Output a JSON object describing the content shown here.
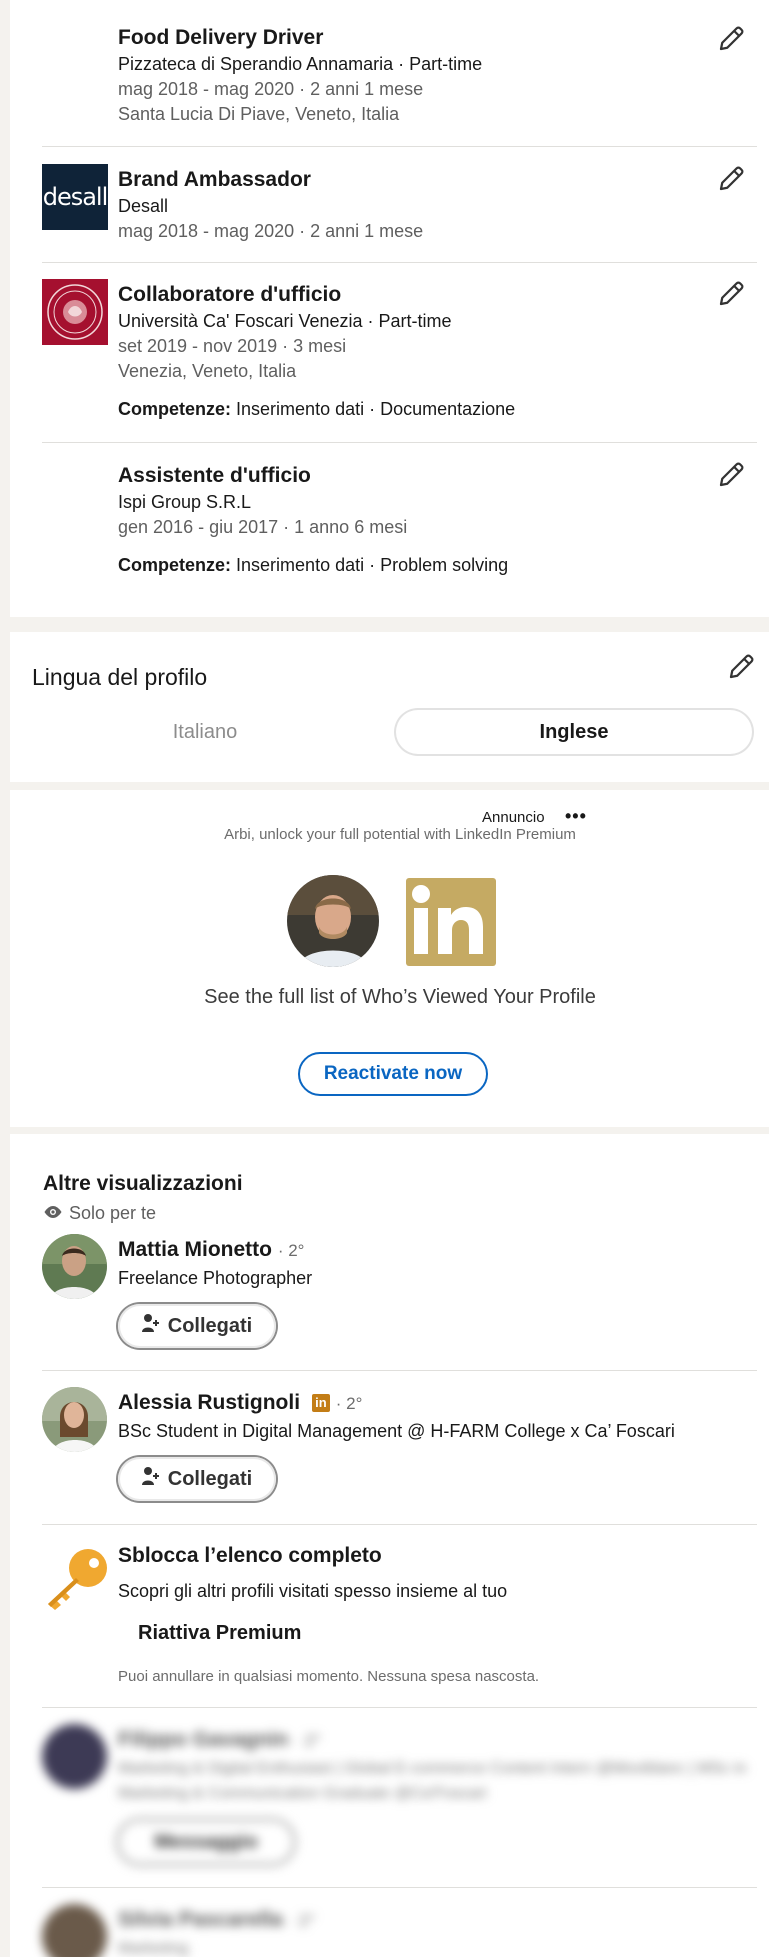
{
  "experience": [
    {
      "title": "Food Delivery Driver",
      "company": "Pizzateca di Sperandio Annamaria · Part-time",
      "dates": "mag 2018 - mag 2020 · 2 anni 1 mese",
      "location": "Santa Lucia Di Piave, Veneto, Italia"
    },
    {
      "title": "Brand Ambassador",
      "company": "Desall",
      "dates": "mag 2018 - mag 2020 · 2 anni 1 mese",
      "logo_text": "desall"
    },
    {
      "title": "Collaboratore d'ufficio",
      "company": "Università Ca' Foscari Venezia · Part-time",
      "dates": "set 2019 - nov 2019 · 3 mesi",
      "location": "Venezia, Veneto, Italia",
      "skills_label": "Competenze:",
      "skills": "Inserimento dati · Documentazione"
    },
    {
      "title": "Assistente d'ufficio",
      "company": "Ispi Group S.R.L",
      "dates": "gen 2016 - giu 2017 · 1 anno 6 mesi",
      "skills_label": "Competenze:",
      "skills": "Inserimento dati · Problem solving"
    }
  ],
  "language": {
    "title": "Lingua del profilo",
    "options": [
      "Italiano",
      "Inglese"
    ],
    "selected": "Inglese"
  },
  "ad": {
    "label": "Annuncio",
    "menu": "•••",
    "subtitle": "Arbi, unlock your full potential with LinkedIn Premium",
    "logo_text": "in",
    "text": "See the full list of Who’s Viewed Your Profile",
    "button": "Reactivate now"
  },
  "others": {
    "title": "Altre visualizzazioni",
    "subtitle": "Solo per te",
    "people": [
      {
        "name": "Mattia Mionetto",
        "degree": "· 2°",
        "headline": "Freelance Photographer",
        "button": "Collegati"
      },
      {
        "name": "Alessia Rustignoli",
        "badge": "in",
        "degree": "· 2°",
        "headline": "BSc Student in Digital Management @ H-FARM College x Ca’ Foscari",
        "button": "Collegati"
      }
    ],
    "unlock": {
      "title": "Sblocca l’elenco completo",
      "desc": "Scopri gli altri profili visitati spesso insieme al tuo",
      "button": "Riattiva Premium",
      "note": "Puoi annullare in qualsiasi momento. Nessuna spesa nascosta."
    },
    "blurred": [
      {
        "name": "Filippo Gavagnin",
        "degree": "· 2°",
        "headline": "Marketing & Digital Enthusiast | Global E-commerce Content Intern @Moviblanc | MSc in Marketing & Communication Graduate @Ca'Foscari",
        "button": "Messaggio"
      },
      {
        "name": "Silvia Pascarella",
        "degree": "· 2°",
        "headline": "Marketing"
      }
    ]
  },
  "colors": {
    "primary": "#0a66c2",
    "premium_gold": "#c5aa63",
    "key_orange": "#f0a830"
  }
}
